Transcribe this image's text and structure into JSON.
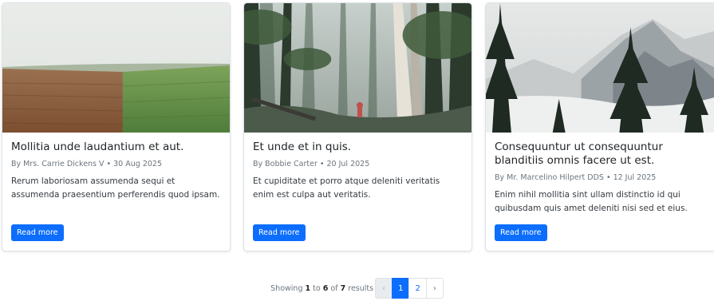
{
  "posts": [
    {
      "title": "Mollitia unde laudantium et aut.",
      "author": "By Mrs. Carrie Dickens V",
      "date": "30 Aug 2025",
      "excerpt": "Rerum laboriosam assumenda sequi et assumenda praesentium perferendis quod ipsam.",
      "button": "Read more"
    },
    {
      "title": "Et unde et in quis.",
      "author": "By Bobbie Carter",
      "date": "20 Jul 2025",
      "excerpt": "Et cupiditate et porro atque deleniti veritatis enim est culpa aut veritatis.",
      "button": "Read more"
    },
    {
      "title": "Consequuntur ut consequuntur blanditiis omnis facere ut est.",
      "author": "By Mr. Marcelino Hilpert DDS",
      "date": "12 Jul 2025",
      "excerpt": "Enim nihil mollitia sint ullam distinctio id qui quibusdam quis amet deleniti nisi sed et eius.",
      "button": "Read more"
    }
  ],
  "separator": "•",
  "pagination": {
    "showing_prefix": "Showing",
    "from": "1",
    "to_word": "to",
    "to": "6",
    "of_word": "of",
    "total": "7",
    "results_word": "results",
    "prev": "‹",
    "pages": [
      "1",
      "2"
    ],
    "next": "›",
    "active_page": "1"
  },
  "colors": {
    "primary": "#0d6efd",
    "muted": "#6c757d"
  }
}
